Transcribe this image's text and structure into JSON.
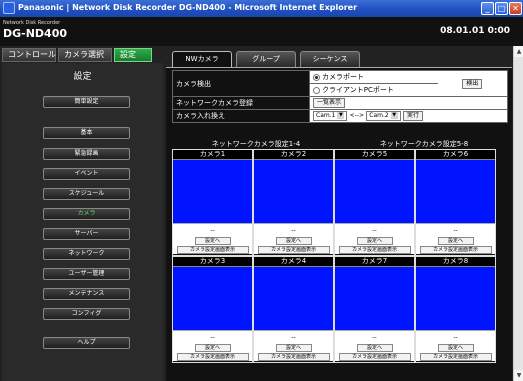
{
  "window": {
    "title": "Panasonic | Network Disk Recorder DG-ND400 - Microsoft Internet Explorer",
    "minimize": "_",
    "maximize": "□",
    "close": "✕"
  },
  "header": {
    "brand_sub": "Network Disk Recorder",
    "brand": "DG-ND400",
    "datetime": "08.01.01  0:00"
  },
  "top_buttons": [
    {
      "label": "コントロール",
      "active": false
    },
    {
      "label": "カメラ選択",
      "active": false
    },
    {
      "label": "設定",
      "active": true
    }
  ],
  "sidebar": {
    "title": "設定",
    "items": [
      {
        "label": "簡単設定"
      },
      {
        "label": "基本"
      },
      {
        "label": "緊急録画"
      },
      {
        "label": "イベント"
      },
      {
        "label": "スケジュール"
      },
      {
        "label": "カメラ",
        "active": true
      },
      {
        "label": "サーバー"
      },
      {
        "label": "ネットワーク"
      },
      {
        "label": "ユーザー管理"
      },
      {
        "label": "メンテナンス"
      },
      {
        "label": "コンフィグ"
      },
      {
        "label": "ヘルプ"
      }
    ]
  },
  "tabs": [
    {
      "label": "NWカメラ",
      "active": true
    },
    {
      "label": "グループ"
    },
    {
      "label": "シーケンス"
    }
  ],
  "form": {
    "camera_detect_label": "カメラ検出",
    "radio_camera_port": "カメラポート",
    "radio_client_port": "クライアントPCポート",
    "detect_button": "検出",
    "network_register_label": "ネットワークカメラ登録",
    "list_display_button": "一覧表示",
    "camera_swap_label": "カメラ入れ換え",
    "swap_from": "Cam.1",
    "swap_arrow": "<-->",
    "swap_to": "Cam.2",
    "execute_button": "実行"
  },
  "grid": {
    "header_left": "ネットワークカメラ設定1-4",
    "header_right": "ネットワークカメラ設定5-8",
    "rows": [
      [
        "カメラ1",
        "カメラ2",
        "カメラ5",
        "カメラ6"
      ],
      [
        "カメラ3",
        "カメラ4",
        "カメラ7",
        "カメラ8"
      ]
    ],
    "name_placeholder": "--",
    "settings_button": "設定へ",
    "show_settings_button": "カメラ設定画面表示"
  },
  "colors": {
    "active_green": "#2fae4c",
    "preview_blue": "#0014ff",
    "titlebar_blue": "#1f4fbf"
  }
}
